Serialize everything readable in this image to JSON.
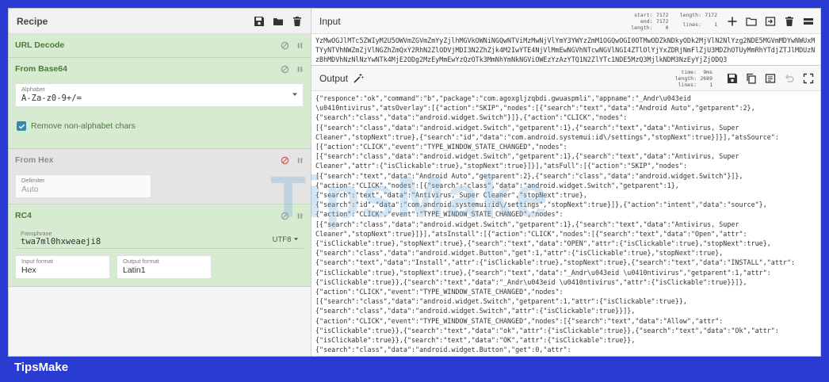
{
  "recipe": {
    "title": "Recipe",
    "icons": [
      "save-icon",
      "folder-icon",
      "trash-icon"
    ]
  },
  "operations": {
    "url_decode": {
      "title": "URL Decode"
    },
    "from_base64": {
      "title": "From Base64",
      "alphabet_label": "Alphabet",
      "alphabet_value": "A-Za-z0-9+/=",
      "remove_label": "Remove non-alphabet chars"
    },
    "from_hex": {
      "title": "From Hex",
      "delimiter_label": "Delimiter",
      "delimiter_value": "Auto"
    },
    "rc4": {
      "title": "RC4",
      "passphrase_label": "Passphrase",
      "passphrase_value": "twa7ml0hxweaeji8",
      "encoding": "UTF8",
      "input_format_label": "Input format",
      "input_format_value": "Hex",
      "output_format_label": "Output format",
      "output_format_value": "Latin1"
    }
  },
  "input": {
    "title": "Input",
    "stats": {
      "start_label": "start:",
      "start": "7172",
      "end_label": "end:",
      "end": "7172",
      "length_label": "length:",
      "sel_length": "0",
      "total_length_label": "length:",
      "total_length": "7172",
      "lines_label": "lines:",
      "lines": "1"
    },
    "text": "YzMwOGJlMTc5ZWIyM2U5OWVmZGVmZmYyZjlhMGVkOWNiNGQwNTViMzMwNjVlYmY3YWYzZmM1OGQwOGI0OTMwODZkNDkyODk2MjVlN2NlYzg2NDE5MGVmMDYwNWUxMTYyNTVhNWZmZjVlNGZhZmQxY2RhN2ZlODVjMDI3N2ZhZjk4M2IwYTE4NjVlMmEwNGVhNTcwNGVlNGI4ZTlOlYjYxZDRjNmFlZjU3MDZhOTUyMmRhYTdjZTJlMDUzNzBhMDVhNzNlNzYwNTk4MjE2ODg2MzEyMmEwYzQzOTk3MmNhYmNkNGViOWEzYzAzYTQ1N2ZlYTc1NDE5MzQ3MjlkNDM3NzEyYjZjODQ3"
  },
  "output": {
    "title": "Output",
    "stats": {
      "time_label": "time:",
      "time": "9ms",
      "length_label": "length:",
      "length": "2689",
      "lines_label": "lines:",
      "lines": "1"
    },
    "lines": [
      "{\"responce\":\"ok\",\"command\":\"b\",\"package\":\"com.agoxgljzqbdi.gwuaspmli\",\"appname\":\"_Andr\\u043eid",
      "\\u0410ntivirus\",\"atsOverlay\":[{\"action\":\"SKIP\",\"nodes\":[{\"search\":\"text\",\"data\":\"Android Auto\",\"getparent\":2},",
      "{\"search\":\"class\",\"data\":\"android.widget.Switch\"}]},{\"action\":\"CLICK\",\"nodes\":",
      "[{\"search\":\"class\",\"data\":\"android.widget.Switch\",\"getparent\":1},{\"search\":\"text\",\"data\":\"Antivirus, Super",
      "Cleaner\",\"stopNext\":true},{\"search\":\"id\",\"data\":\"com.android.systemui:id\\/settings\",\"stopNext\":true}]}],\"atsSource\":",
      "[{\"action\":\"CLICK\",\"event\":\"TYPE_WINDOW_STATE_CHANGED\",\"nodes\":",
      "[{\"search\":\"class\",\"data\":\"android.widget.Switch\",\"getparent\":1},{\"search\":\"text\",\"data\":\"Antivirus, Super",
      "Cleaner\",\"attr\":{\"isClickable\":true},\"stopNext\":true}]}],\"atsFull\":[{\"action\":\"SKIP\",\"nodes\":",
      "[{\"search\":\"text\",\"data\":\"Android Auto\",\"getparent\":2},{\"search\":\"class\",\"data\":\"android.widget.Switch\"}]},",
      "{\"action\":\"CLICK\",\"nodes\":[{\"search\":\"class\",\"data\":\"android.widget.Switch\",\"getparent\":1},",
      "{\"search\":\"text\",\"data\":\"Antivirus, Super Cleaner\",\"stopNext\":true},",
      "{\"search\":\"id\",\"data\":\"com.android.systemui:id\\/settings\",\"stopNext\":true}]},{\"action\":\"intent\",\"data\":\"source\"},",
      "{\"action\":\"CLICK\",\"event\":\"TYPE_WINDOW_STATE_CHANGED\",\"nodes\":",
      "[{\"search\":\"class\",\"data\":\"android.widget.Switch\",\"getparent\":1},{\"search\":\"text\",\"data\":\"Antivirus, Super",
      "Cleaner\",\"stopNext\":true}]}],\"atsInstall\":[{\"action\":\"CLICK\",\"nodes\":[{\"search\":\"text\",\"data\":\"Open\",\"attr\":",
      "{\"isClickable\":true},\"stopNext\":true},{\"search\":\"text\",\"data\":\"OPEN\",\"attr\":{\"isClickable\":true},\"stopNext\":true},",
      "{\"search\":\"class\",\"data\":\"android.widget.Button\",\"get\":1,\"attr\":{\"isClickable\":true},\"stopNext\":true},",
      "{\"search\":\"text\",\"data\":\"Install\",\"attr\":{\"isClickable\":true},\"stopNext\":true},{\"search\":\"text\",\"data\":\"INSTALL\",\"attr\":",
      "{\"isClickable\":true},\"stopNext\":true},{\"search\":\"text\",\"data\":\"_Andr\\u043eid \\u0410ntivirus\",\"getparent\":1,\"attr\":",
      "{\"isClickable\":true}},{\"search\":\"text\",\"data\":\"_Andr\\u043eid \\u0410ntivirus\",\"attr\":{\"isClickable\":true}}]},",
      "{\"action\":\"CLICK\",\"event\":\"TYPE_WINDOW_STATE_CHANGED\",\"nodes\":",
      "[{\"search\":\"class\",\"data\":\"android.widget.Switch\",\"getparent\":1,\"attr\":{\"isClickable\":true}},",
      "{\"search\":\"class\",\"data\":\"android.widget.Switch\",\"attr\":{\"isClickable\":true}}]},",
      "{\"action\":\"CLICK\",\"event\":\"TYPE_WINDOW_STATE_CHANGED\",\"nodes\":[{\"search\":\"text\",\"data\":\"Allow\",\"attr\":",
      "{\"isClickable\":true}},{\"search\":\"text\",\"data\":\"ok\",\"attr\":{\"isClickable\":true}},{\"search\":\"text\",\"data\":\"Ok\",\"attr\":",
      "{\"isClickable\":true}},{\"search\":\"text\",\"data\":\"OK\",\"attr\":{\"isClickable\":true}},",
      "{\"search\":\"class\",\"data\":\"android.widget.Button\",\"get\":0,\"attr\":"
    ]
  },
  "watermark": "TipsMake",
  "brand": "TipsMake"
}
